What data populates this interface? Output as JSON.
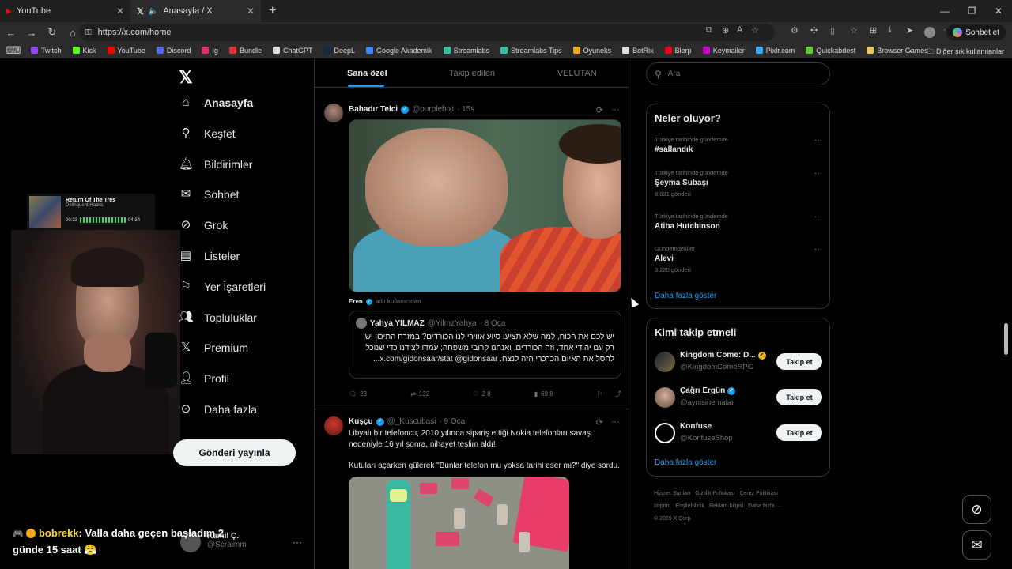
{
  "browser": {
    "tabs": [
      {
        "label": "YouTube",
        "active": false
      },
      {
        "label": "Anasayfa / X",
        "active": true
      }
    ],
    "new_tab": "+",
    "url": "https://x.com/home",
    "copilot_label": "Sohbet et",
    "bookmarks": [
      {
        "label": "Twitch",
        "color": "#9146ff"
      },
      {
        "label": "Kick",
        "color": "#53fc18"
      },
      {
        "label": "YouTube",
        "color": "#ff0000"
      },
      {
        "label": "Discord",
        "color": "#5865f2"
      },
      {
        "label": "Ig",
        "color": "#e1306c"
      },
      {
        "label": "Bundle",
        "color": "#d33"
      },
      {
        "label": "ChatGPT",
        "color": "#ddd"
      },
      {
        "label": "DeepL",
        "color": "#0f2b46"
      },
      {
        "label": "Google Akademik",
        "color": "#4285f4"
      },
      {
        "label": "Streamlabs",
        "color": "#31c3a2"
      },
      {
        "label": "Streamlabs Tips",
        "color": "#31c3a2"
      },
      {
        "label": "Oyuneks",
        "color": "#f5a623"
      },
      {
        "label": "BotRix",
        "color": "#ddd"
      },
      {
        "label": "Blerp",
        "color": "#e02"
      },
      {
        "label": "Keymailer",
        "color": "#c0c"
      },
      {
        "label": "Pixlr.com",
        "color": "#3af"
      },
      {
        "label": "Quickabdest",
        "color": "#6c3"
      },
      {
        "label": "Browser Games",
        "color": "#e9c46a"
      }
    ],
    "bookmarks_other": "Diğer sık kullanılanlar"
  },
  "nav": {
    "items": [
      {
        "label": "Anasayfa",
        "icon": "home-icon"
      },
      {
        "label": "Keşfet",
        "icon": "search-icon"
      },
      {
        "label": "Bildirimler",
        "icon": "bell-icon"
      },
      {
        "label": "Sohbet",
        "icon": "mail-icon"
      },
      {
        "label": "Grok",
        "icon": "grok-icon"
      },
      {
        "label": "Listeler",
        "icon": "list-icon"
      },
      {
        "label": "Yer İşaretleri",
        "icon": "bookmark-icon"
      },
      {
        "label": "Topluluklar",
        "icon": "communities-icon"
      },
      {
        "label": "Premium",
        "icon": "x-icon"
      },
      {
        "label": "Profil",
        "icon": "profile-icon"
      },
      {
        "label": "Daha fazla",
        "icon": "more-icon"
      }
    ],
    "post_button": "Gönderi yayınla",
    "account_name": "Kamil Ç.",
    "account_handle": "@Scraimm"
  },
  "overlay": {
    "song_title": "Return Of The Tres",
    "song_artist": "Delinquent Habits",
    "time_current": "00:33",
    "time_total": "04:34",
    "chat_user": "bobrekk",
    "chat_message": ": Valla daha geçen başladım 2 günde 15 saat"
  },
  "timeline": {
    "tabs": [
      "Sana özel",
      "Takip edilen",
      "VELUTAN"
    ],
    "tweet1": {
      "name": "Bahadır Telci",
      "handle": "@purplebixi",
      "time": "· 15s",
      "retweet_by": "Eren",
      "retweet_note": "adlı kullanıcıdan",
      "quote_name": "Yahya YILMAZ",
      "quote_handle": "@YilmzYahya",
      "quote_time": "· 8 Oca",
      "quote_text": "יש לכם את הכוח, למה שלא תציעו סיוע אווירי לנו הכורדים? במזרח התיכון יש רק עם יהודי אחד, וזה הכורדים. ואנחנו קרובי משפחה; עמדו לצידנו כדי שנוכל לחסל את האיום הכרכרי הזה לנצח. x.com/gidonsaar/stat @gidonsaar...",
      "replies": "23",
      "reposts": "132",
      "likes": "2 8",
      "views": "69 8"
    },
    "tweet2": {
      "name": "Kuşçu",
      "handle": "@_Kuscubasi",
      "time": "· 9 Oca",
      "text": "Libyalı bir telefoncu, 2010 yılında sipariş ettiği Nokia telefonları savaş nedeniyle 16 yıl sonra, nihayet teslim aldı!\n\nKutuları açarken gülerek \"Bunlar telefon mu yoksa tarihi eser mi?\" diye sordu."
    }
  },
  "sidebar": {
    "search_placeholder": "Ara",
    "trends_title": "Neler oluyor?",
    "trends": [
      {
        "context": "Türkiye tarihinde gündemde",
        "name": "#sallandık",
        "posts": ""
      },
      {
        "context": "Türkiye tarihinde gündemde",
        "name": "Şeyma Subaşı",
        "posts": "8.031 gönderi"
      },
      {
        "context": "Türkiye tarihinde gündemde",
        "name": "Atiba Hutchinson",
        "posts": ""
      },
      {
        "context": "Gündemdekiler",
        "name": "Alevi",
        "posts": "3.220 gönderi"
      }
    ],
    "show_more": "Daha fazla göster",
    "who_title": "Kimi takip etmeli",
    "who": [
      {
        "name": "Kingdom Come: D...",
        "handle": "@KingdomComeRPG",
        "follow": "Takip et"
      },
      {
        "name": "Çağrı Ergün",
        "handle": "@aynisinemalar",
        "follow": "Takip et"
      },
      {
        "name": "Konfuse",
        "handle": "@KonfuseShop",
        "follow": "Takip et"
      }
    ],
    "footer": [
      "Hizmet Şartları",
      "Gizlilik Politikası",
      "Çerez Politikası",
      "Imprint",
      "Erişilebilirlik",
      "Reklam bilgisi",
      "Daha fazla ···",
      "© 2026 X Corp."
    ]
  }
}
